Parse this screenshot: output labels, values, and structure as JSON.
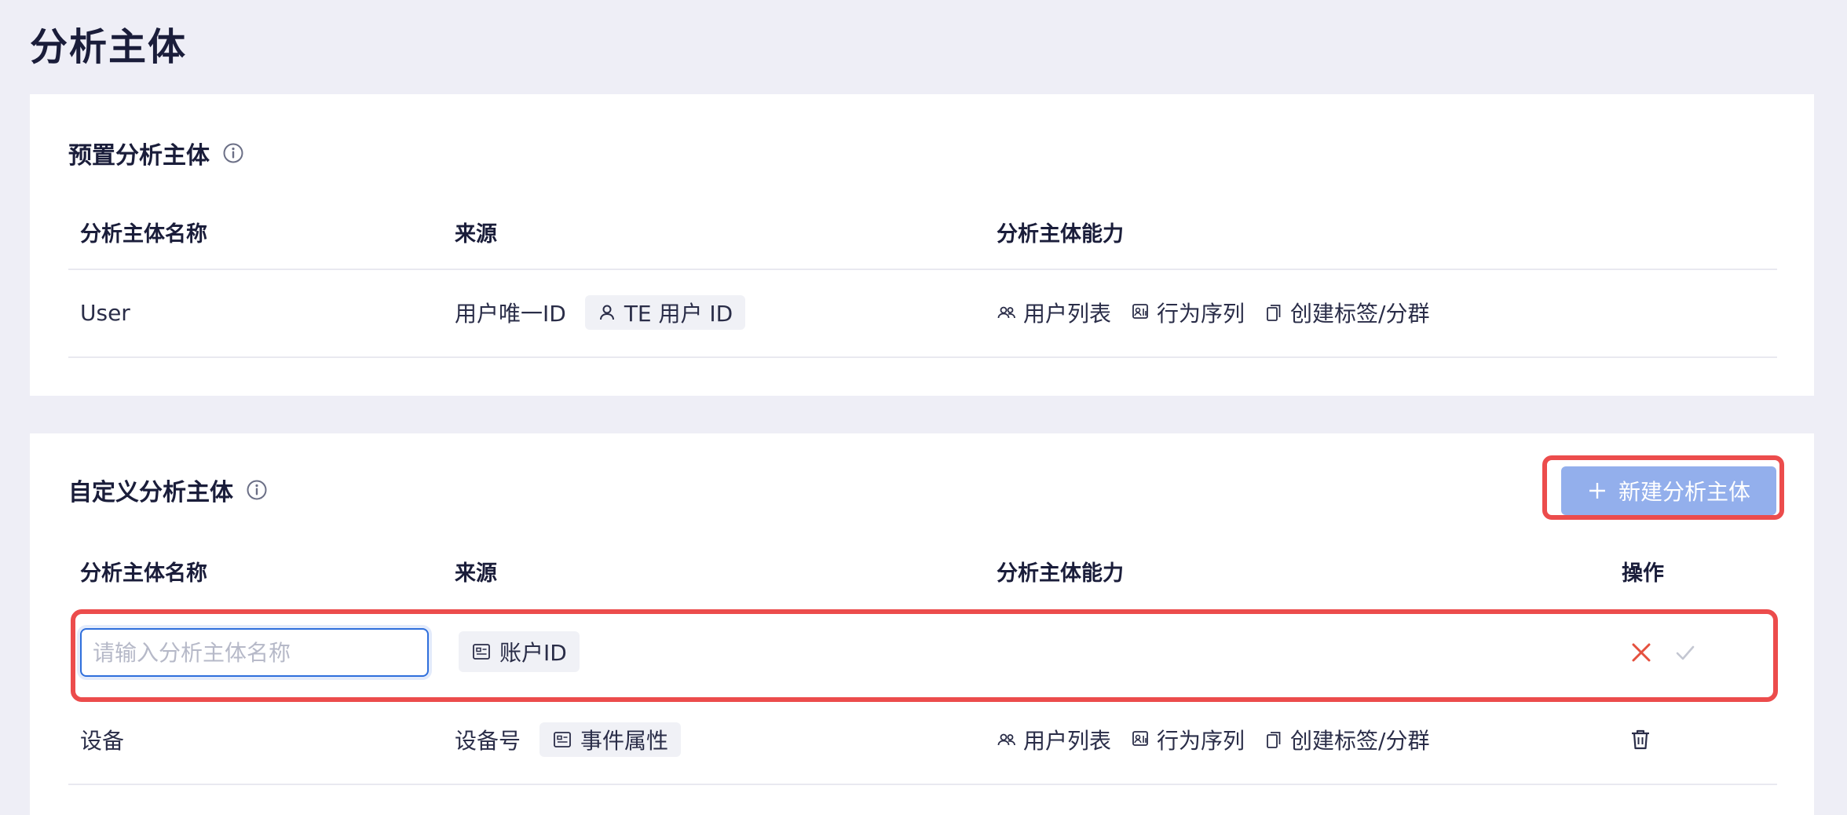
{
  "page_title": "分析主体",
  "preset": {
    "title": "预置分析主体",
    "columns": [
      "分析主体名称",
      "来源",
      "分析主体能力"
    ],
    "rows": [
      {
        "name": "User",
        "source_text": "用户唯一ID",
        "source_tag": "TE 用户 ID",
        "capabilities": [
          "用户列表",
          "行为序列",
          "创建标签/分群"
        ]
      }
    ]
  },
  "custom": {
    "title": "自定义分析主体",
    "new_button_label": "新建分析主体",
    "columns": [
      "分析主体名称",
      "来源",
      "分析主体能力",
      "操作"
    ],
    "editing_row": {
      "name_placeholder": "请输入分析主体名称",
      "name_value": "",
      "source_tag": "账户ID"
    },
    "rows": [
      {
        "name": "设备",
        "source_text": "设备号",
        "source_tag": "事件属性",
        "capabilities": [
          "用户列表",
          "行为序列",
          "创建标签/分群"
        ]
      }
    ]
  },
  "colors": {
    "highlight": "#ec4c4c",
    "primary_button": "#93afec",
    "cancel_icon": "#e5503e",
    "confirm_icon": "#c4c7d2"
  },
  "icons": {
    "info": "info-icon",
    "user": "user-icon",
    "users": "users-icon",
    "behavior": "behavior-sequence-icon",
    "tag": "tag-group-icon",
    "id_card": "id-card-icon",
    "plus": "plus-icon",
    "close": "close-icon",
    "check": "check-icon",
    "trash": "trash-icon"
  }
}
